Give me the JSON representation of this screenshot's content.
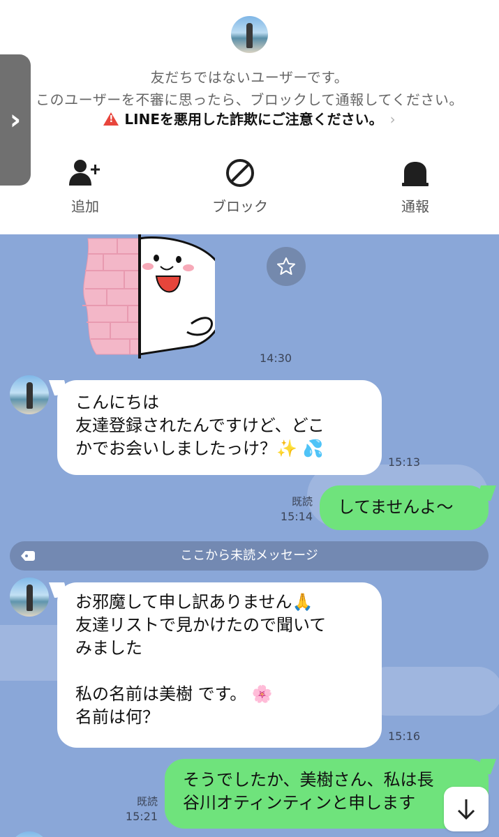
{
  "header": {
    "notice_line1": "友だちではないユーザーです。",
    "notice_line2": "このユーザーを不審に思ったら、ブロックして通報してください。",
    "warning": "LINEを悪用した詐欺にご注意ください。",
    "warning_chevron": "›",
    "side_tab": "›",
    "actions": [
      {
        "icon": "add-friend-icon",
        "label": "追加"
      },
      {
        "icon": "block-icon",
        "label": "ブロック"
      },
      {
        "icon": "report-icon",
        "label": "通報"
      }
    ]
  },
  "chat": {
    "sticker_time": "14:30",
    "messages": [
      {
        "direction": "in",
        "lines": [
          "こんにちは",
          "友達登録されたんですけど、どこ",
          "かでお会いしましたっけ？✨ 💦"
        ],
        "time": "15:13"
      },
      {
        "direction": "out",
        "lines": [
          "してませんよ〜"
        ],
        "read": "既読",
        "time": "15:14"
      },
      {
        "direction": "in",
        "lines": [
          "お邪魔して申し訳ありません🙏",
          "友達リストで見かけたので聞いて",
          "みました",
          "",
          "私の名前は美樹 です。 🌸",
          "名前は何？"
        ],
        "time": "15:16"
      },
      {
        "direction": "out",
        "lines": [
          "そうでしたか、美樹さん、私は長",
          "谷川オティンティンと申します"
        ],
        "read": "既読",
        "time": "15:21"
      }
    ],
    "unread_divider": "ここから未読メッセージ"
  },
  "colors": {
    "chat_background": "#8aa7d8",
    "outgoing_bubble": "#6fe37c",
    "incoming_bubble": "#ffffff",
    "divider": "#7389b2",
    "warning_red": "#e8453c"
  }
}
